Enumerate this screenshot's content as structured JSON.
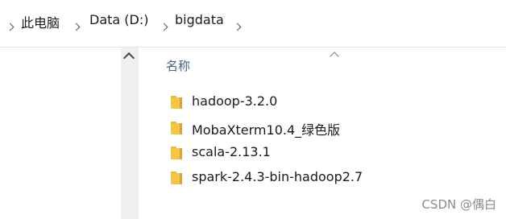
{
  "breadcrumb": {
    "items": [
      {
        "label": "此电脑",
        "icon": "chevron-right-icon"
      },
      {
        "label": "Data (D:)",
        "icon": "chevron-right-icon"
      },
      {
        "label": "bigdata",
        "icon": "chevron-right-icon"
      }
    ],
    "trailing_icon": "chevron-right-icon"
  },
  "file_list": {
    "column_header": "名称",
    "sort_indicator_icon": "sort-ascending-caret-icon",
    "items": [
      {
        "name": "hadoop-3.2.0",
        "icon": "folder-icon"
      },
      {
        "name": "MobaXterm10.4_绿色版",
        "icon": "folder-icon"
      },
      {
        "name": "scala-2.13.1",
        "icon": "folder-icon"
      },
      {
        "name": "spark-2.4.3-bin-hadoop2.7",
        "icon": "folder-icon"
      }
    ]
  },
  "nav_pane": {
    "scroll_up_icon": "chevron-up-icon"
  },
  "watermark": "CSDN @偶白",
  "colors": {
    "folder": "#f2c54b",
    "folder_shade": "#dca532",
    "header_text": "#4c607a",
    "scroll_track": "#f0f0f0"
  }
}
